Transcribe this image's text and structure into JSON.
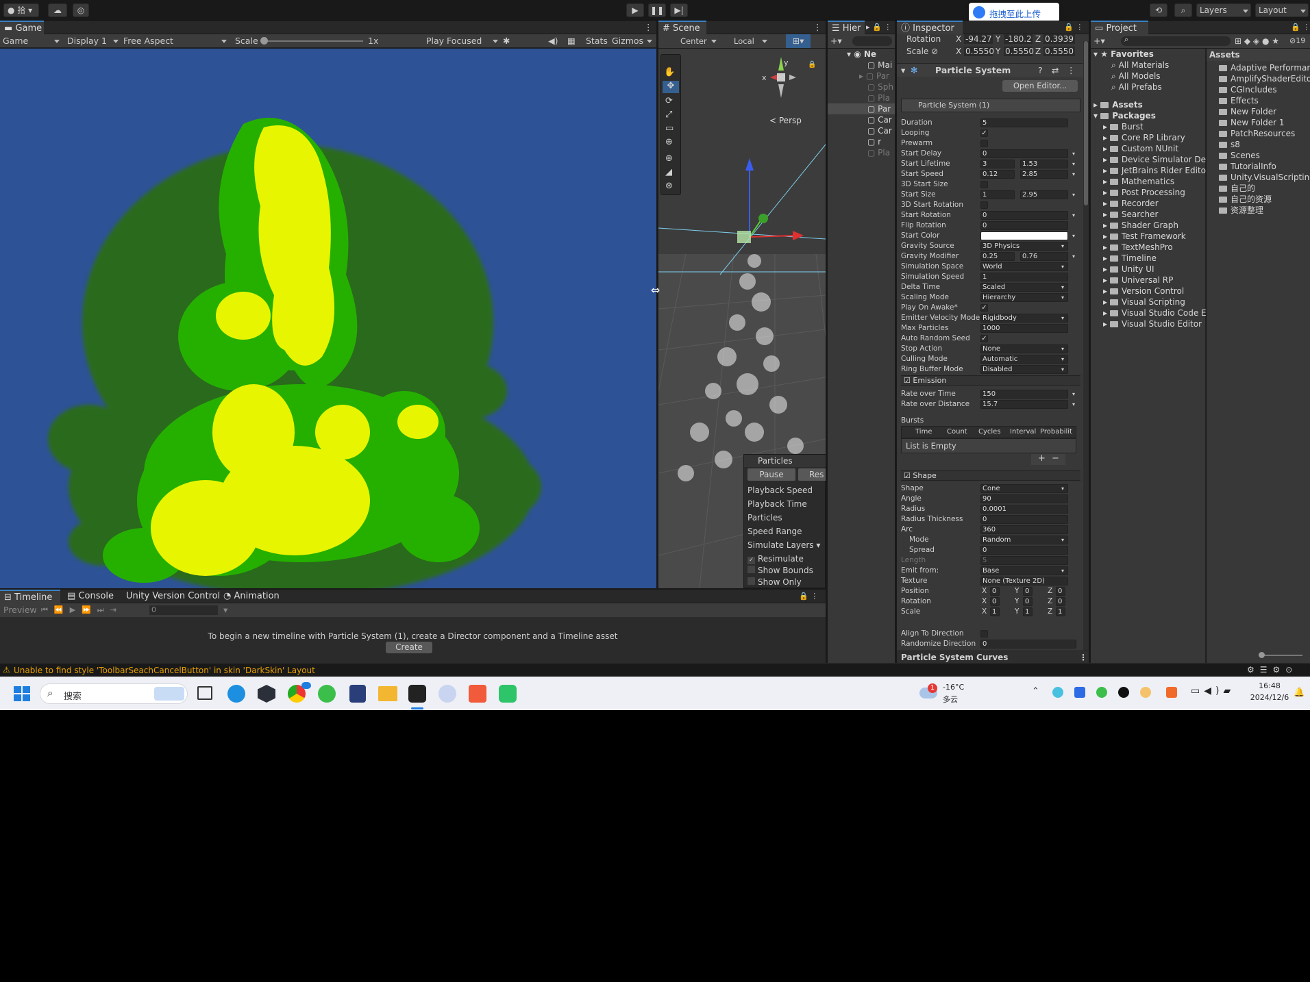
{
  "topbar": {
    "account": "拾",
    "cloud_label": "cloud",
    "layers_label": "Layers",
    "layout_label": "Layout",
    "upload_banner": "拖拽至此上传"
  },
  "game": {
    "tab": "Game",
    "mode": "Game",
    "display": "Display 1",
    "aspect": "Free Aspect",
    "scale_label": "Scale",
    "scale_value": "1x",
    "play_focused": "Play Focused",
    "stats": "Stats",
    "gizmos": "Gizmos"
  },
  "scene": {
    "tab": "Scene",
    "pivot": "Center",
    "space": "Local",
    "persp": "Persp",
    "particles_overlay": {
      "title": "Particles",
      "pause": "Pause",
      "restart": "Res",
      "items": [
        "Playback Speed",
        "Playback Time",
        "Particles",
        "Speed Range",
        "Simulate Layers"
      ],
      "checks": [
        {
          "label": "Resimulate",
          "checked": true
        },
        {
          "label": "Show Bounds",
          "checked": false
        },
        {
          "label": "Show Only Selec",
          "checked": false
        }
      ]
    }
  },
  "hierarchy": {
    "tab": "Hier",
    "root": "Ne",
    "items": [
      "Mai",
      "Par",
      "Sph",
      "Pla",
      "Par",
      "Car",
      "Car",
      "r",
      "Pla"
    ]
  },
  "inspector": {
    "tab": "Inspector",
    "transform": {
      "rotation_label": "Rotation",
      "rot_x": "-94.27",
      "rot_y": "-180.2",
      "rot_z": "0.3939",
      "scale_label": "Scale",
      "scale_x": "0.5550",
      "scale_y": "0.5550",
      "scale_z": "0.5550"
    },
    "component": "Particle System",
    "open_editor": "Open Editor...",
    "system_name": "Particle System (1)",
    "main_rows": [
      {
        "label": "Duration",
        "value": "5"
      },
      {
        "label": "Looping",
        "check": true
      },
      {
        "label": "Prewarm",
        "check": false
      },
      {
        "label": "Start Delay",
        "value": "0",
        "dd": true
      },
      {
        "label": "Start Lifetime",
        "value": "3",
        "value2": "1.53",
        "dd": true
      },
      {
        "label": "Start Speed",
        "value": "0.12",
        "value2": "2.85",
        "dd": true
      },
      {
        "label": "3D Start Size",
        "check": false
      },
      {
        "label": "Start Size",
        "value": "1",
        "value2": "2.95",
        "dd": true
      },
      {
        "label": "3D Start Rotation",
        "check": false
      },
      {
        "label": "Start Rotation",
        "value": "0",
        "dd": true
      },
      {
        "label": "Flip Rotation",
        "value": "0"
      },
      {
        "label": "Start Color",
        "color": "#ffffff",
        "dd": true
      },
      {
        "label": "Gravity Source",
        "value": "3D Physics",
        "select": true
      },
      {
        "label": "Gravity Modifier",
        "value": "0.25",
        "value2": "0.76",
        "dd": true
      },
      {
        "label": "Simulation Space",
        "value": "World",
        "select": true
      },
      {
        "label": "Simulation Speed",
        "value": "1"
      },
      {
        "label": "Delta Time",
        "value": "Scaled",
        "select": true
      },
      {
        "label": "Scaling Mode",
        "value": "Hierarchy",
        "select": true
      },
      {
        "label": "Play On Awake*",
        "check": true
      },
      {
        "label": "Emitter Velocity Mode",
        "value": "Rigidbody",
        "select": true
      },
      {
        "label": "Max Particles",
        "value": "1000"
      },
      {
        "label": "Auto Random Seed",
        "check": true
      },
      {
        "label": "Stop Action",
        "value": "None",
        "select": true
      },
      {
        "label": "Culling Mode",
        "value": "Automatic",
        "select": true
      },
      {
        "label": "Ring Buffer Mode",
        "value": "Disabled",
        "select": true
      }
    ],
    "emission": {
      "title": "Emission",
      "rate_time_label": "Rate over Time",
      "rate_time": "150",
      "rate_dist_label": "Rate over Distance",
      "rate_dist": "15.7",
      "bursts_label": "Bursts",
      "cols": [
        "Time",
        "Count",
        "Cycles",
        "Interval",
        "Probabilit"
      ],
      "empty": "List is Empty"
    },
    "shape": {
      "title": "Shape",
      "rows": [
        {
          "label": "Shape",
          "value": "Cone",
          "select": true
        },
        {
          "label": "Angle",
          "value": "90"
        },
        {
          "label": "Radius",
          "value": "0.0001"
        },
        {
          "label": "Radius Thickness",
          "value": "0"
        },
        {
          "label": "Arc",
          "value": "360"
        },
        {
          "label": "Mode",
          "value": "Random",
          "select": true,
          "indent": true
        },
        {
          "label": "Spread",
          "value": "0",
          "indent": true
        },
        {
          "label": "Length",
          "value": "5",
          "dim": true
        },
        {
          "label": "Emit from:",
          "value": "Base",
          "select": true
        },
        {
          "label": "Texture",
          "value": "None (Texture 2D)"
        }
      ],
      "position_label": "Position",
      "pos": [
        "0",
        "0",
        "0"
      ],
      "rotation_label": "Rotation",
      "rot": [
        "0",
        "0",
        "0"
      ],
      "scale_label": "Scale",
      "scl": [
        "1",
        "1",
        "1"
      ],
      "align_label": "Align To Direction",
      "randomize_label": "Randomize Direction",
      "randomize": "0"
    },
    "curves": "Particle System Curves"
  },
  "project": {
    "tab": "Project",
    "favorites": "Favorites",
    "fav_items": [
      "All Materials",
      "All Models",
      "All Prefabs"
    ],
    "assets": "Assets",
    "packages": "Packages",
    "package_items": [
      "Burst",
      "Core RP Library",
      "Custom NUnit",
      "Device Simulator Dev",
      "JetBrains Rider Editor",
      "Mathematics",
      "Post Processing",
      "Recorder",
      "Searcher",
      "Shader Graph",
      "Test Framework",
      "TextMeshPro",
      "Timeline",
      "Unity UI",
      "Universal RP",
      "Version Control",
      "Visual Scripting",
      "Visual Studio Code E",
      "Visual Studio Editor"
    ],
    "assets_header": "Assets",
    "asset_items": [
      "Adaptive Performanc",
      "AmplifyShaderEditor",
      "CGIncludes",
      "Effects",
      "New Folder",
      "New Folder 1",
      "PatchResources",
      "s8",
      "Scenes",
      "TutorialInfo",
      "Unity.VisualScripting",
      "自己的",
      "自己的资源",
      "资源整理"
    ],
    "count": "19"
  },
  "timeline": {
    "tabs": [
      "Timeline",
      "Console",
      "Unity Version Control",
      "Animation"
    ],
    "preview": "Preview",
    "frame": "0",
    "message": "To begin a new timeline with Particle System (1), create a Director component and a Timeline asset",
    "create": "Create"
  },
  "status": {
    "warning": "Unable to find style 'ToolbarSeachCancelButton' in skin 'DarkSkin' Layout"
  },
  "taskbar": {
    "search": "搜索",
    "weather_temp": "-16°C",
    "weather_desc": "多云",
    "time": "16:48",
    "date": "2024/12/6",
    "badge": "1"
  }
}
